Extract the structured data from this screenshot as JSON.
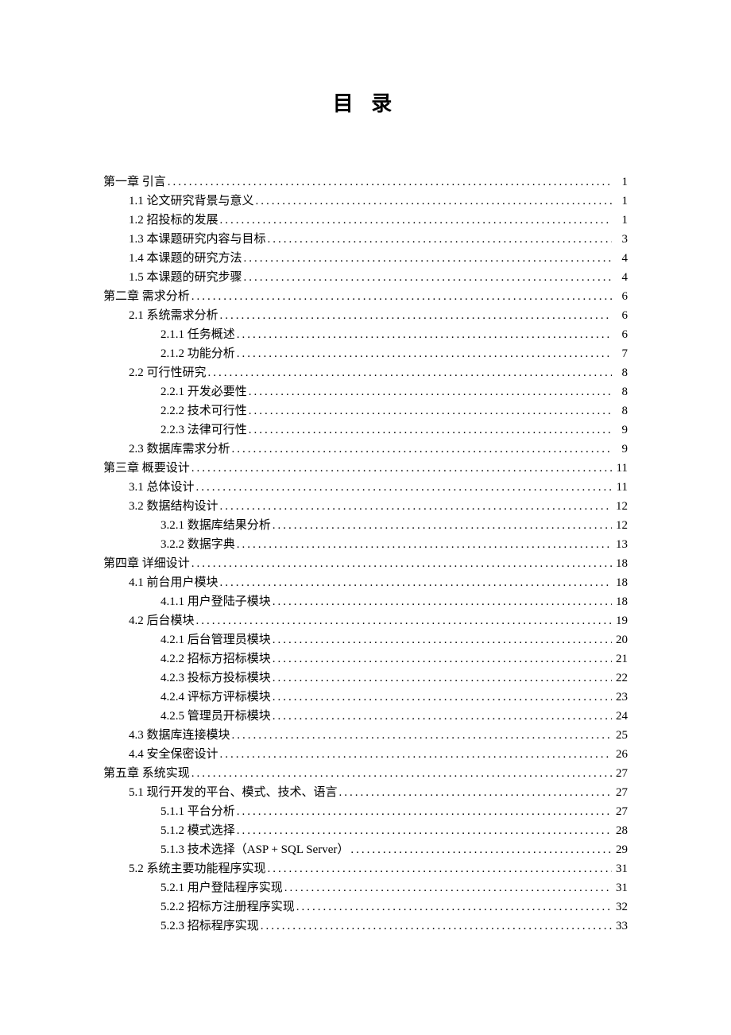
{
  "title": "目 录",
  "entries": [
    {
      "indent": 0,
      "label": "第一章 引言",
      "page": "1"
    },
    {
      "indent": 1,
      "label": "1.1 论文研究背景与意义",
      "page": "1"
    },
    {
      "indent": 1,
      "label": "1.2 招投标的发展",
      "page": "1"
    },
    {
      "indent": 1,
      "label": "1.3 本课题研究内容与目标",
      "page": "3"
    },
    {
      "indent": 1,
      "label": "1.4 本课题的研究方法",
      "page": "4"
    },
    {
      "indent": 1,
      "label": "1.5 本课题的研究步骤",
      "page": "4"
    },
    {
      "indent": 0,
      "label": "第二章 需求分析",
      "page": "6"
    },
    {
      "indent": 1,
      "label": "2.1 系统需求分析",
      "page": "6"
    },
    {
      "indent": 2,
      "label": "2.1.1 任务概述",
      "page": "6"
    },
    {
      "indent": 2,
      "label": "2.1.2 功能分析",
      "page": "7"
    },
    {
      "indent": 1,
      "label": "2.2 可行性研究",
      "page": "8"
    },
    {
      "indent": 2,
      "label": "2.2.1 开发必要性",
      "page": "8"
    },
    {
      "indent": 2,
      "label": "2.2.2 技术可行性",
      "page": "8"
    },
    {
      "indent": 2,
      "label": "2.2.3 法律可行性",
      "page": "9"
    },
    {
      "indent": 1,
      "label": "2.3 数据库需求分析",
      "page": "9"
    },
    {
      "indent": 0,
      "label": "第三章 概要设计",
      "page": "11"
    },
    {
      "indent": 1,
      "label": "3.1 总体设计",
      "page": "11"
    },
    {
      "indent": 1,
      "label": "3.2 数据结构设计",
      "page": "12"
    },
    {
      "indent": 2,
      "label": "3.2.1 数据库结果分析",
      "page": "12"
    },
    {
      "indent": 2,
      "label": "3.2.2 数据字典",
      "page": "13"
    },
    {
      "indent": 0,
      "label": "第四章 详细设计",
      "page": "18"
    },
    {
      "indent": 1,
      "label": "4.1 前台用户模块",
      "page": "18"
    },
    {
      "indent": 2,
      "label": "4.1.1 用户登陆子模块",
      "page": "18"
    },
    {
      "indent": 1,
      "label": "4.2 后台模块",
      "page": "19"
    },
    {
      "indent": 2,
      "label": "4.2.1 后台管理员模块",
      "page": "20"
    },
    {
      "indent": 2,
      "label": "4.2.2 招标方招标模块",
      "page": "21"
    },
    {
      "indent": 2,
      "label": "4.2.3 投标方投标模块",
      "page": "22"
    },
    {
      "indent": 2,
      "label": "4.2.4 评标方评标模块",
      "page": "23"
    },
    {
      "indent": 2,
      "label": "4.2.5 管理员开标模块",
      "page": "24"
    },
    {
      "indent": 1,
      "label": "4.3 数据库连接模块",
      "page": "25"
    },
    {
      "indent": 1,
      "label": "4.4 安全保密设计",
      "page": "26"
    },
    {
      "indent": 0,
      "label": "第五章 系统实现",
      "page": "27"
    },
    {
      "indent": 1,
      "label": "5.1 现行开发的平台、模式、技术、语言",
      "page": "27"
    },
    {
      "indent": 2,
      "label": "5.1.1  平台分析",
      "page": "27"
    },
    {
      "indent": 2,
      "label": "5.1.2  模式选择",
      "page": "28"
    },
    {
      "indent": 2,
      "label": "5.1.3  技术选择（ASP + SQL Server）",
      "page": "29"
    },
    {
      "indent": 1,
      "label": "5.2 系统主要功能程序实现",
      "page": "31"
    },
    {
      "indent": 2,
      "label": "5.2.1 用户登陆程序实现",
      "page": "31"
    },
    {
      "indent": 2,
      "label": "5.2.2 招标方注册程序实现",
      "page": "32"
    },
    {
      "indent": 2,
      "label": "5.2.3 招标程序实现",
      "page": "33"
    }
  ]
}
